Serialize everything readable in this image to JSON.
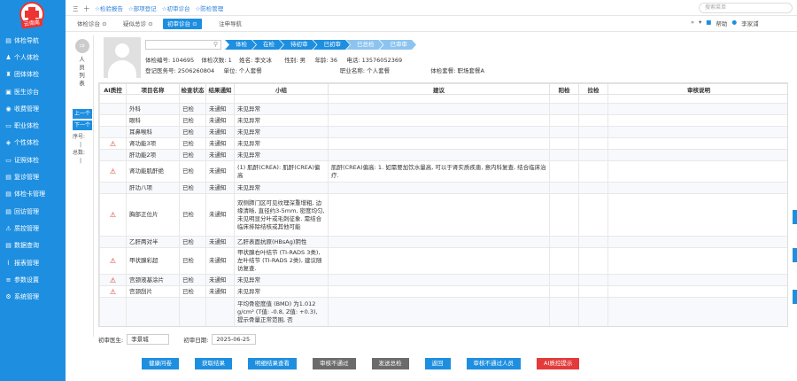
{
  "logo": {
    "badge": "云南南"
  },
  "sidebar": {
    "items": [
      {
        "icon": "▤",
        "label": "体检导航"
      },
      {
        "icon": "♟",
        "label": "个人体检"
      },
      {
        "icon": "♜",
        "label": "团体体检"
      },
      {
        "icon": "▣",
        "label": "医生诊台"
      },
      {
        "icon": "◉",
        "label": "收费管理"
      },
      {
        "icon": "▭",
        "label": "职业体检"
      },
      {
        "icon": "◈",
        "label": "个性体检"
      },
      {
        "icon": "▭",
        "label": "证照体检"
      },
      {
        "icon": "▤",
        "label": "复诊管理"
      },
      {
        "icon": "▤",
        "label": "体检卡管理"
      },
      {
        "icon": "▤",
        "label": "回访管理"
      },
      {
        "icon": "⚠",
        "label": "质控管理"
      },
      {
        "icon": "▤",
        "label": "数据查询"
      },
      {
        "icon": "⌇",
        "label": "报表管理"
      },
      {
        "icon": "≡",
        "label": "参数设置"
      },
      {
        "icon": "⚙",
        "label": "系统管理"
      }
    ]
  },
  "topbar": {
    "quick_links": [
      "三",
      "十",
      "☆检验报告",
      "☆部项登记",
      "☆初审诊台",
      "☆防检管理"
    ],
    "search_placeholder": "搜索菜单",
    "right": {
      "bell": "▾",
      "help": "帮助",
      "user": "李家浦"
    }
  },
  "tabs": [
    "体检诊台 ⊙",
    "疑似总诊 ⊙",
    "初审诊台 ⊙",
    "注申导航"
  ],
  "rail": {
    "label_lines": [
      "人",
      "员",
      "列",
      "表"
    ],
    "prev": "上一个",
    "next": "下一个",
    "seq_label": "序号:",
    "seq_value": "|",
    "total_label": "总数:",
    "total_value": "|"
  },
  "patient": {
    "steps": [
      "体检",
      "在检",
      "待初审",
      "已初审",
      "已总检",
      "已审审"
    ],
    "step_states": [
      "done",
      "done",
      "done",
      "done",
      "future",
      "future"
    ],
    "line1": {
      "exam_no_label": "体检编号:",
      "exam_no": "104695",
      "times_label": "体检次数:",
      "times": "1",
      "name_label": "姓名:",
      "name": "李文冰",
      "sex_label": "性别:",
      "sex": "男",
      "age_label": "年龄:",
      "age": "36",
      "phone_label": "电话:",
      "phone": "13576052369"
    },
    "line2": {
      "reg_label": "登记医务号:",
      "reg": "2506260804",
      "unit_label": "单位:",
      "unit": "个人套餐",
      "career_label": "职业名称:",
      "career": "个人套餐",
      "pkg_label": "体检套餐:",
      "pkg": "职场套餐A"
    }
  },
  "table": {
    "headers": [
      "AI质控",
      "项目名称",
      "检查状态",
      "结果通知",
      "小结",
      "建议",
      "阳检",
      "拉检",
      "审核说明"
    ],
    "rows": [
      {
        "ai": "",
        "name": "",
        "status": "",
        "notify": "",
        "summary": "",
        "advice": ""
      },
      {
        "ai": "",
        "name": "外科",
        "status": "已检",
        "notify": "未通知",
        "summary": "未见异常",
        "advice": ""
      },
      {
        "ai": "",
        "name": "眼科",
        "status": "已检",
        "notify": "未通知",
        "summary": "未见异常",
        "advice": ""
      },
      {
        "ai": "",
        "name": "耳鼻喉科",
        "status": "已检",
        "notify": "未通知",
        "summary": "未见异常",
        "advice": ""
      },
      {
        "ai": "⚠",
        "name": "肾功能3项",
        "status": "已检",
        "notify": "未通知",
        "summary": "未见异常",
        "advice": ""
      },
      {
        "ai": "",
        "name": "肝功能2项",
        "status": "已检",
        "notify": "未通知",
        "summary": "未见异常",
        "advice": ""
      },
      {
        "ai": "⚠",
        "name": "肾功能肌酐绝",
        "status": "已检",
        "notify": "未通知",
        "summary": "(1) 肌酐(CREA): 肌酐(CREA)偏高",
        "advice": "肌酐(CREA)偏高: 1. 如需要加饮水量高, 可以于肾实质疾患, 意内科复查, 结合临床治疗."
      },
      {
        "ai": "",
        "name": "肝功八项",
        "status": "已检",
        "notify": "未通知",
        "summary": "未见异常",
        "advice": ""
      },
      {
        "ai": "⚠",
        "name": "胸部正位片",
        "status": "已检",
        "notify": "未通知",
        "summary": "双侧肺门区可见纹理深重增粗, 边缘清晰, 直径约3-5mm, 密度均匀, 未见明显分叶或毛刺征象. 需结合临床排除结核或其他可能",
        "advice": ""
      },
      {
        "ai": "",
        "name": "乙肝两对半",
        "status": "已检",
        "notify": "未通知",
        "summary": "乙肝表面抗原(HBsAg)阴性",
        "advice": ""
      },
      {
        "ai": "⚠",
        "name": "甲状腺彩超",
        "status": "已检",
        "notify": "未通知",
        "summary": "甲状腺右叶结节 (TI-RADS 3类), 左叶结节 (TI-RADS 2类), 建议随访复查.",
        "advice": ""
      },
      {
        "ai": "⚠",
        "name": "宫颈液基涂片",
        "status": "已检",
        "notify": "未通知",
        "summary": "未见异常",
        "advice": ""
      },
      {
        "ai": "⚠",
        "name": "宫颈刮片",
        "status": "已检",
        "notify": "未通知",
        "summary": "未见异常",
        "advice": ""
      },
      {
        "ai": "",
        "name": "",
        "status": "",
        "notify": "",
        "summary": "平均骨密度值 (BMD) 为1.012 g/cm² (T值: -0.8, Z值: +0.3), 提示骨量正常范围, 否",
        "advice": ""
      }
    ]
  },
  "bottom": {
    "doctor_label": "初审医生:",
    "doctor": "李景城",
    "date_label": "初审日期:",
    "date": "2025-06-25",
    "buttons": [
      {
        "label": "健康问卷",
        "style": "blue"
      },
      {
        "label": "获取结果",
        "style": "blue"
      },
      {
        "label": "明细结果查看",
        "style": "blue"
      },
      {
        "label": "审核不通过",
        "style": "grey"
      },
      {
        "label": "发送总检",
        "style": "grey"
      },
      {
        "label": "返回",
        "style": "blue"
      },
      {
        "label": "审核不通过人员",
        "style": "blue"
      },
      {
        "label": "AI质控提示",
        "style": "red"
      }
    ]
  }
}
